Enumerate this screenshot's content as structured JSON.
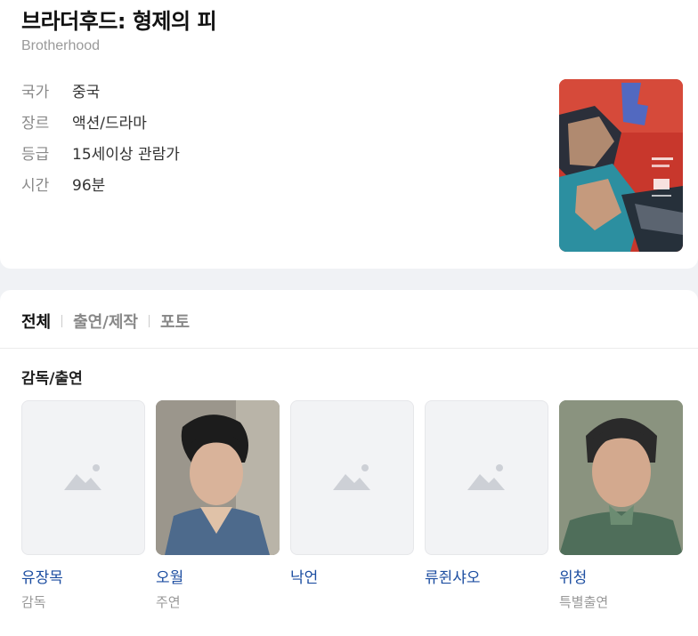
{
  "movie": {
    "title": "브라더후드: 형제의 피",
    "original_title": "Brotherhood",
    "info": [
      {
        "key": "국가",
        "value": "중국"
      },
      {
        "key": "장르",
        "value": "액션/드라마"
      },
      {
        "key": "등급",
        "value": "15세이상 관람가"
      },
      {
        "key": "시간",
        "value": "96분"
      }
    ],
    "poster_icon": "movie-poster"
  },
  "tabs": [
    {
      "label": "전체",
      "active": true
    },
    {
      "label": "출연/제작",
      "active": false
    },
    {
      "label": "포토",
      "active": false
    }
  ],
  "cast_section": {
    "title": "감독/출연",
    "people": [
      {
        "name": "유장목",
        "role": "감독",
        "photo": "placeholder-image-icon"
      },
      {
        "name": "오월",
        "role": "주연",
        "photo": "actor-photo"
      },
      {
        "name": "낙언",
        "role": "",
        "photo": "placeholder-image-icon"
      },
      {
        "name": "류쥔샤오",
        "role": "",
        "photo": "placeholder-image-icon"
      },
      {
        "name": "위청",
        "role": "특별출연",
        "photo": "actor-photo"
      }
    ]
  }
}
